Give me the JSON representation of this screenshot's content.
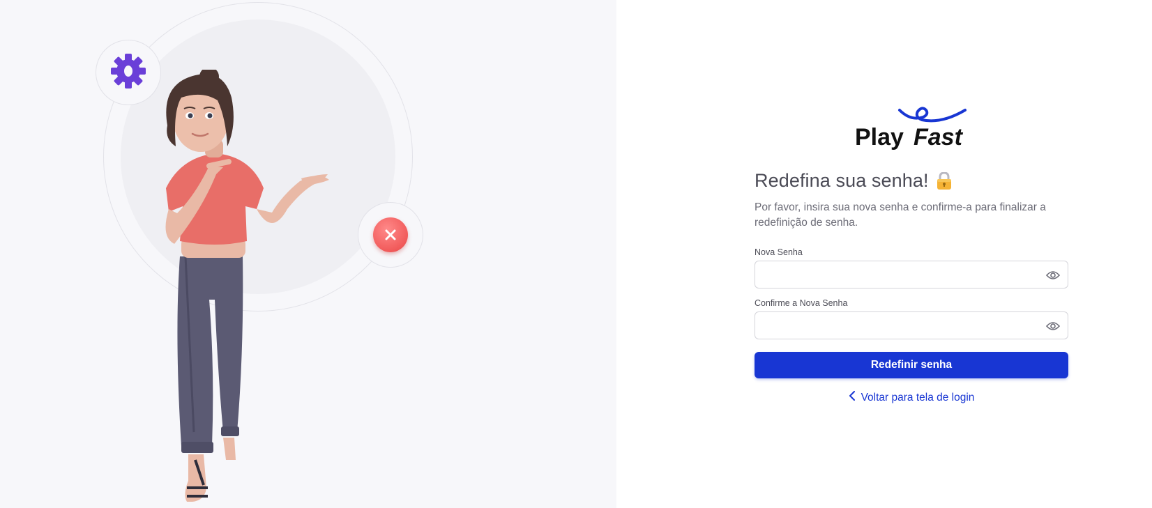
{
  "brand": {
    "name_plain": "Play",
    "name_italic": "Fast",
    "color": "#1836d3"
  },
  "form": {
    "title": "Redefina sua senha!",
    "title_icon": "lock-icon",
    "subtitle": "Por favor, insira sua nova senha e confirme-a para finalizar a redefinição de senha.",
    "new_password": {
      "label": "Nova Senha",
      "value": "",
      "toggle_icon": "eye-icon"
    },
    "confirm_password": {
      "label": "Confirme a Nova Senha",
      "value": "",
      "toggle_icon": "eye-icon"
    },
    "submit_label": "Redefinir senha",
    "back_link_label": "Voltar para tela de login",
    "back_link_icon": "chevron-left-icon"
  },
  "illustration": {
    "icons": [
      "gear-icon",
      "close-icon"
    ],
    "colors": {
      "gear": "#6a3fd8",
      "close": "#f15a5a",
      "background": "#f7f7fa"
    }
  }
}
